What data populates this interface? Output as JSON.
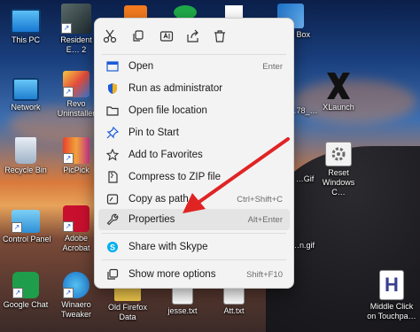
{
  "desktop": {
    "icons": [
      {
        "label": "This PC"
      },
      {
        "label": "Resident E… 2"
      },
      {
        "label": "Network"
      },
      {
        "label": "Revo Uninstaller"
      },
      {
        "label": "Recycle Bin"
      },
      {
        "label": "PicPick"
      },
      {
        "label": "Control Panel"
      },
      {
        "label": "Adobe Acrobat"
      },
      {
        "label": "Google Chat"
      },
      {
        "label": "Winaero Tweaker"
      },
      {
        "label": "Old Firefox Data"
      },
      {
        "label": "jesse.txt"
      },
      {
        "label": "Att.txt"
      },
      {
        "label": "VM Box"
      },
      {
        "label": "XLaunch"
      },
      {
        "label": "Reset Windows C…"
      },
      {
        "label": "Middle Click on Touchpa…"
      },
      {
        "label": "…78_…"
      },
      {
        "label": "…Gif"
      },
      {
        "label": "…n.gif"
      }
    ]
  },
  "context_menu": {
    "toolbar": [
      {
        "name": "cut"
      },
      {
        "name": "copy"
      },
      {
        "name": "rename"
      },
      {
        "name": "share"
      },
      {
        "name": "delete"
      }
    ],
    "items": [
      {
        "label": "Open",
        "shortcut": "Enter"
      },
      {
        "label": "Run as administrator",
        "shortcut": ""
      },
      {
        "label": "Open file location",
        "shortcut": ""
      },
      {
        "label": "Pin to Start",
        "shortcut": ""
      },
      {
        "label": "Add to Favorites",
        "shortcut": ""
      },
      {
        "label": "Compress to ZIP file",
        "shortcut": ""
      },
      {
        "label": "Copy as path",
        "shortcut": "Ctrl+Shift+C"
      },
      {
        "label": "Properties",
        "shortcut": "Alt+Enter"
      },
      {
        "label": "Share with Skype",
        "shortcut": ""
      },
      {
        "label": "Show more options",
        "shortcut": "Shift+F10"
      }
    ]
  },
  "colors": {
    "accent": "#1c5bd8",
    "arrow": "#e02424",
    "menu_bg": "#f3f3f3"
  }
}
